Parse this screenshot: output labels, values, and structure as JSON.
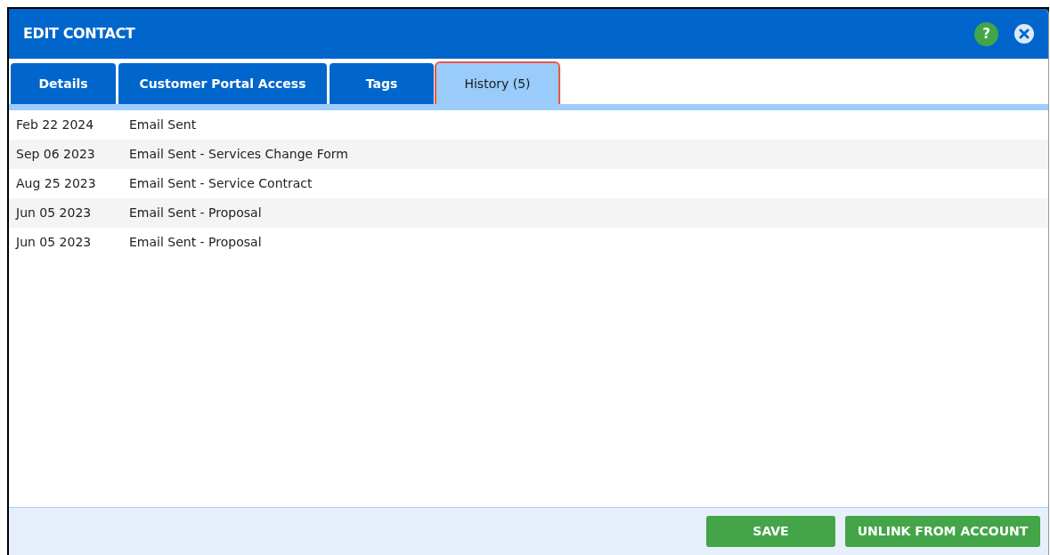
{
  "dialog": {
    "title": "EDIT CONTACT",
    "help": "?"
  },
  "tabs": [
    {
      "label": "Details",
      "selected": false
    },
    {
      "label": "Customer Portal Access",
      "selected": false
    },
    {
      "label": "Tags",
      "selected": false
    },
    {
      "label": "History (5)",
      "selected": true
    }
  ],
  "history": [
    {
      "date": "Feb 22 2024",
      "event": "Email Sent"
    },
    {
      "date": "Sep 06 2023",
      "event": "Email Sent - Services Change Form"
    },
    {
      "date": "Aug 25 2023",
      "event": "Email Sent - Service Contract"
    },
    {
      "date": "Jun 05 2023",
      "event": "Email Sent - Proposal"
    },
    {
      "date": "Jun 05 2023",
      "event": "Email Sent - Proposal"
    }
  ],
  "buttons": [
    "SAVE",
    "UNLINK FROM ACCOUNT"
  ]
}
